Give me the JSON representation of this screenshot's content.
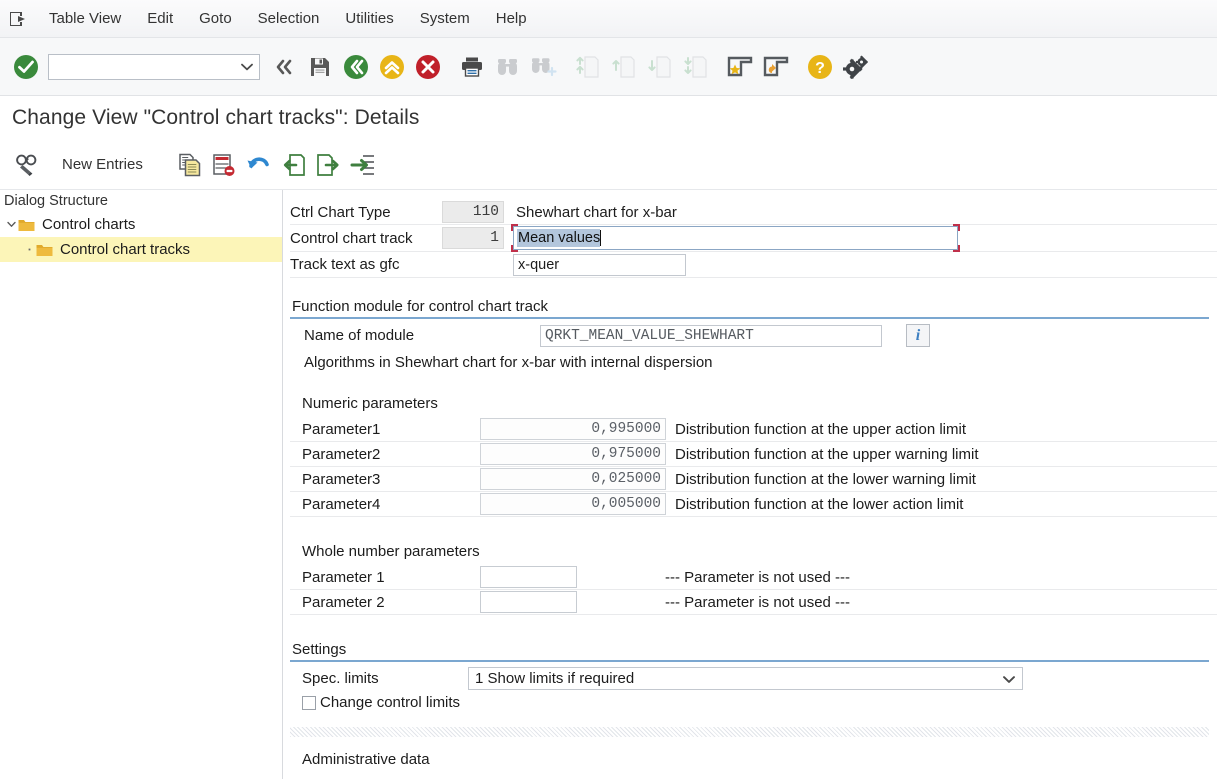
{
  "menu": {
    "system_icon": "sap-logo-icon",
    "items": [
      {
        "label": "Table View",
        "accel": "T"
      },
      {
        "label": "Edit",
        "accel": "E"
      },
      {
        "label": "Goto",
        "accel": "G"
      },
      {
        "label": "Selection",
        "accel": "l"
      },
      {
        "label": "Utilities",
        "accel": "s"
      },
      {
        "label": "System",
        "accel": "y"
      },
      {
        "label": "Help",
        "accel": "H"
      }
    ]
  },
  "system_toolbar": {
    "enter": {
      "name": "enter-check-icon",
      "color": "#3a8a3c"
    },
    "command_field": {
      "value": "",
      "placeholder": ""
    },
    "dropdown_arrow": "chevron-down-icon",
    "buttons": [
      {
        "name": "menu-collapse-icon",
        "enabled": true
      },
      {
        "name": "save-icon",
        "enabled": true
      },
      {
        "name": "back-icon",
        "enabled": true,
        "color": "#3a8a3c"
      },
      {
        "name": "exit-icon",
        "enabled": true,
        "color": "#e8b517"
      },
      {
        "name": "cancel-icon",
        "enabled": true,
        "color": "#c0202a"
      },
      {
        "name": "print-icon",
        "enabled": true
      },
      {
        "name": "find-icon",
        "enabled": false
      },
      {
        "name": "find-next-icon",
        "enabled": false
      },
      {
        "name": "first-page-icon",
        "enabled": false
      },
      {
        "name": "previous-page-icon",
        "enabled": false
      },
      {
        "name": "next-page-icon",
        "enabled": false
      },
      {
        "name": "last-page-icon",
        "enabled": false
      },
      {
        "name": "create-shortcut-icon",
        "enabled": true
      },
      {
        "name": "create-new-session-icon",
        "enabled": true
      },
      {
        "name": "help-icon",
        "enabled": true,
        "color": "#e8b517"
      },
      {
        "name": "customize-local-layout-icon",
        "enabled": true
      }
    ]
  },
  "title": {
    "text": "Change View \"Control chart tracks\": Details"
  },
  "app_toolbar": {
    "display_change_icon": "display-change-glasses-icon",
    "new_entries_label": "New Entries",
    "buttons": [
      {
        "name": "copy-as-icon"
      },
      {
        "name": "delete-row-icon"
      },
      {
        "name": "undo-icon"
      },
      {
        "name": "previous-entry-icon"
      },
      {
        "name": "next-entry-icon"
      },
      {
        "name": "variable-list-icon"
      }
    ]
  },
  "tree": {
    "header": "Dialog Structure",
    "nodes": [
      {
        "label": "Control charts",
        "level": 1,
        "expanded": true,
        "selected": false,
        "icon": "folder-open-icon"
      },
      {
        "label": "Control chart tracks",
        "level": 2,
        "expanded": false,
        "selected": true,
        "icon": "folder-icon"
      }
    ]
  },
  "form": {
    "header_rows": [
      {
        "label": "Ctrl Chart Type",
        "key_value": "110",
        "text": "Shewhart chart for x-bar"
      },
      {
        "label": "Control chart track",
        "key_value": "1",
        "text": "Mean values",
        "focused": true,
        "selected": true
      },
      {
        "label": "Track text as gfc",
        "key_value": "",
        "text": "x-quer"
      }
    ],
    "function_module": {
      "group_title": "Function module for control chart track",
      "name_label": "Name of module",
      "name_value": "QRKT_MEAN_VALUE_SHEWHART",
      "info_button": "information-icon",
      "description": "Algorithms in Shewhart chart for x-bar with internal dispersion"
    },
    "numeric_parameters": {
      "section_title": "Numeric parameters",
      "rows": [
        {
          "label": "Parameter1",
          "value": "0,995000",
          "desc": "Distribution function at the upper action limit"
        },
        {
          "label": "Parameter2",
          "value": "0,975000",
          "desc": "Distribution function at the upper warning limit"
        },
        {
          "label": "Parameter3",
          "value": "0,025000",
          "desc": "Distribution function at the lower warning limit"
        },
        {
          "label": "Parameter4",
          "value": "0,005000",
          "desc": "Distribution function at the lower action limit"
        }
      ]
    },
    "whole_number_parameters": {
      "section_title": "Whole number parameters",
      "rows": [
        {
          "label": "Parameter 1",
          "value": "",
          "desc": "--- Parameter is not used ---"
        },
        {
          "label": "Parameter 2",
          "value": "",
          "desc": "--- Parameter is not used ---"
        }
      ]
    },
    "settings": {
      "group_title": "Settings",
      "spec_limits_label": "Spec. limits",
      "spec_limits_value": "1 Show limits if required",
      "spec_limits_options": [
        "1 Show limits if required"
      ],
      "change_control_limits_label": "Change control limits",
      "change_control_limits_checked": false
    },
    "administrative": {
      "section_title": "Administrative data"
    }
  }
}
